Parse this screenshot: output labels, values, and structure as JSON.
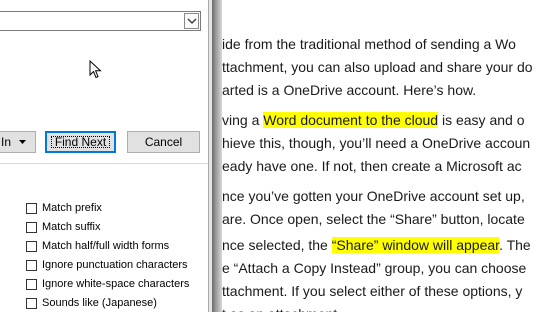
{
  "dialog": {
    "find_what_value": "",
    "buttons": {
      "more_label": "In",
      "find_next_label": "Find Next",
      "cancel_label": "Cancel"
    },
    "options": [
      {
        "label": "Match prefix",
        "checked": false
      },
      {
        "label": "Match suffix",
        "checked": false
      },
      {
        "label": "Match half/full width forms",
        "checked": false
      },
      {
        "label": "Ignore punctuation characters",
        "checked": false
      },
      {
        "label": "Ignore white-space characters",
        "checked": false
      },
      {
        "label": "Sounds like (Japanese)",
        "checked": false
      }
    ]
  },
  "document": {
    "lines": [
      {
        "segments": [
          {
            "text": "ide from the traditional method of sending a Wo"
          }
        ]
      },
      {
        "segments": [
          {
            "text": "ttachment, you can also upload and share your do"
          }
        ]
      },
      {
        "segments": [
          {
            "text": "arted is a OneDrive account. Here’s how."
          }
        ]
      },
      {
        "segments": [
          {
            "text": "ving a "
          },
          {
            "text": "Word document to the cloud",
            "highlight": true
          },
          {
            "text": " is easy and o"
          }
        ]
      },
      {
        "segments": [
          {
            "text": "hieve this, though, you’ll need a OneDrive accoun"
          }
        ]
      },
      {
        "segments": [
          {
            "text": "eady have one. If not, then create a Microsoft ac"
          }
        ]
      },
      {
        "segments": [
          {
            "text": "nce you’ve gotten your OneDrive account set up,"
          }
        ]
      },
      {
        "segments": [
          {
            "text": "are. Once open, select the “Share” button, locate"
          }
        ]
      },
      {
        "segments": [
          {
            "text": "nce selected, the "
          },
          {
            "text": "“Share” window will appear",
            "highlight": true
          },
          {
            "text": ". The"
          }
        ]
      },
      {
        "segments": [
          {
            "text": "e “Attach a Copy Instead” group, you can choose"
          }
        ]
      },
      {
        "segments": [
          {
            "text": "ttachment. If you select either of these options, y"
          }
        ]
      },
      {
        "segments": [
          {
            "text": "t as an attachment."
          }
        ]
      }
    ]
  },
  "colors": {
    "highlight": "#ffff00",
    "focus_border": "#0078d7",
    "button_face": "#e1e1e1"
  },
  "icons": {
    "combo_arrow": "chevron-down-icon",
    "more_arrow": "triangle-down-icon",
    "cursor": "mouse-pointer-icon"
  }
}
